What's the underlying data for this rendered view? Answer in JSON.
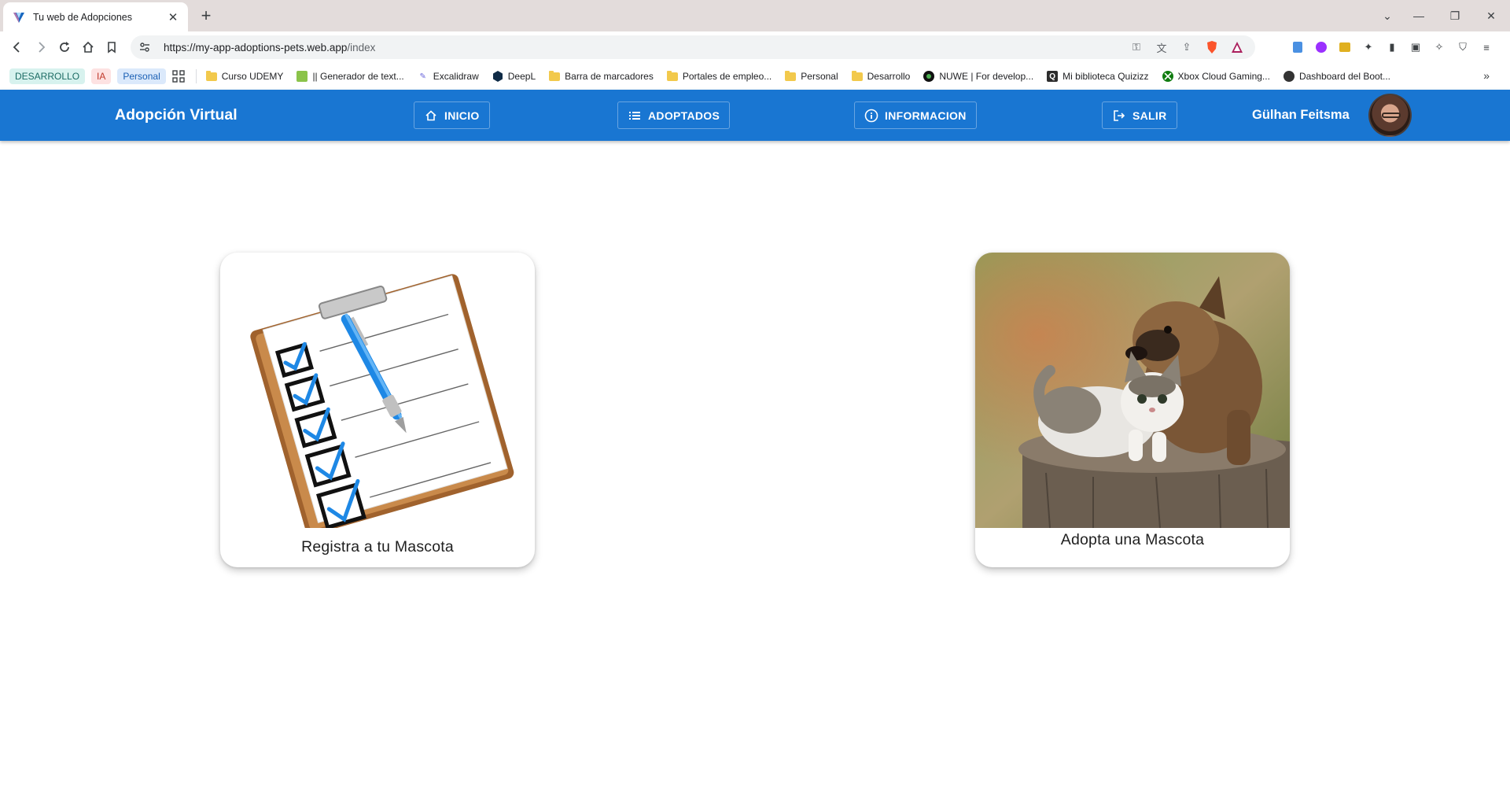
{
  "browser": {
    "tab_title": "Tu web de Adopciones",
    "url_host": "https://my-app-adoptions-pets.web.app",
    "url_path": "/index",
    "bookmarks": {
      "badges": [
        {
          "label": "DESARROLLO",
          "bg": "#d7f2ee",
          "fg": "#1b6b63"
        },
        {
          "label": "IA",
          "bg": "#fde2e2",
          "fg": "#c0392b"
        },
        {
          "label": "Personal",
          "bg": "#dbe9fb",
          "fg": "#1a5fb4"
        }
      ],
      "items": [
        {
          "label": "Curso UDEMY",
          "icon": "folder-icon"
        },
        {
          "label": "|| Generador de text...",
          "icon": "generator-icon"
        },
        {
          "label": "Excalidraw",
          "icon": "excalidraw-icon"
        },
        {
          "label": "DeepL",
          "icon": "deepl-icon"
        },
        {
          "label": "Barra de marcadores",
          "icon": "folder-icon"
        },
        {
          "label": "Portales de empleo...",
          "icon": "folder-icon"
        },
        {
          "label": "Personal",
          "icon": "folder-icon"
        },
        {
          "label": "Desarrollo",
          "icon": "folder-icon"
        },
        {
          "label": "NUWE | For develop...",
          "icon": "nuwe-icon"
        },
        {
          "label": "Mi biblioteca Quizizz",
          "icon": "quizizz-icon"
        },
        {
          "label": "Xbox Cloud Gaming...",
          "icon": "xbox-icon"
        },
        {
          "label": "Dashboard del Boot...",
          "icon": "bootcamp-icon"
        }
      ]
    }
  },
  "app": {
    "brand": "Adopción Virtual",
    "accent": "#1976d2",
    "nav": {
      "inicio": "INICIO",
      "adoptados": "ADOPTADOS",
      "informacion": "INFORMACION",
      "salir": "SALIR"
    },
    "user_name": "Gülhan Feitsma"
  },
  "cards": {
    "register": {
      "caption": "Registra a tu Mascota",
      "image_icon": "clipboard-checklist-icon"
    },
    "adopt": {
      "caption": "Adopta una Mascota",
      "image_icon": "puppy-kitten-photo"
    }
  }
}
